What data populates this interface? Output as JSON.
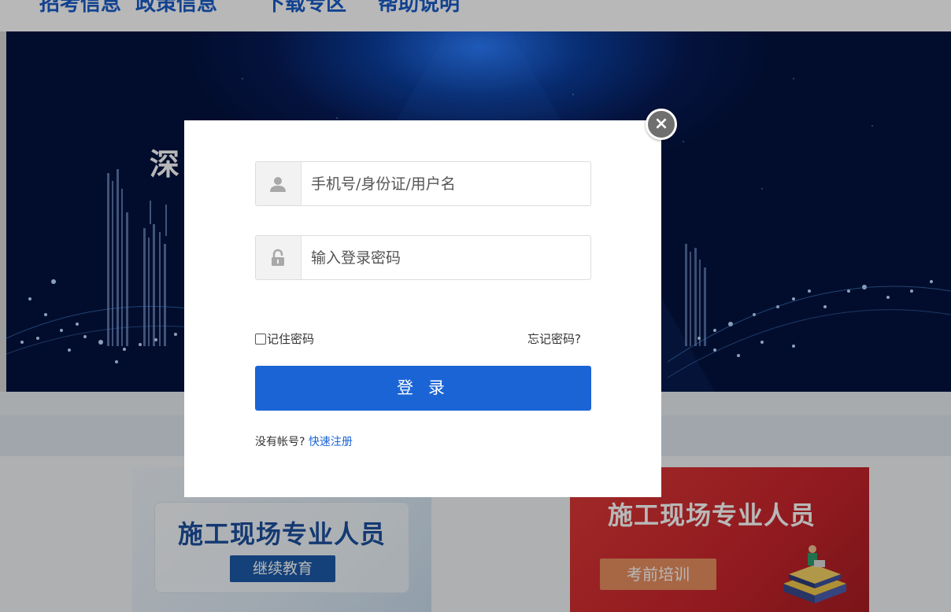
{
  "nav": {
    "items": [
      "招考信息",
      "政策信息",
      "下载专区",
      "帮助说明"
    ]
  },
  "banner": {
    "title_partial": "深"
  },
  "cards": {
    "left": {
      "title": "施工现场专业人员",
      "tag": "继续教育"
    },
    "right": {
      "title": "施工现场专业人员",
      "tag": "考前培训"
    }
  },
  "login": {
    "close_label": "×",
    "username_placeholder": "手机号/身份证/用户名",
    "password_placeholder": "输入登录密码",
    "remember_label": "记住密码",
    "forgot_label": "忘记密码?",
    "login_button": "登 录",
    "no_account_text": "没有帐号?",
    "register_link": "快速注册",
    "icons": {
      "user": "user-icon",
      "lock": "lock-icon",
      "close": "close-icon"
    }
  },
  "colors": {
    "primary": "#1a64d6",
    "banner": "#0b3e9e",
    "card_red": "#c9252c",
    "card_blue_text": "#1d4f9e"
  }
}
